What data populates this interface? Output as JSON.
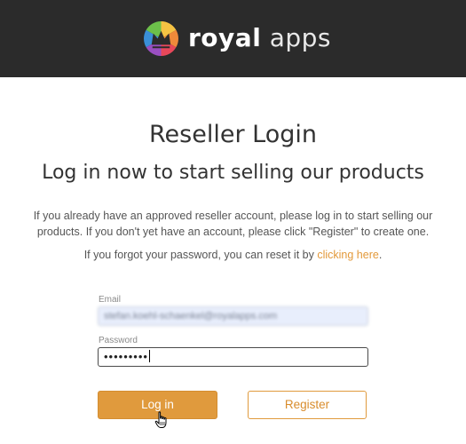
{
  "header": {
    "brand_bold": "royal",
    "brand_light": " apps",
    "logo_icon": "crown-logo-icon"
  },
  "main": {
    "title": "Reseller Login",
    "subtitle": "Log in now to start selling our products",
    "intro": "If you already have an approved reseller account, please log in to start selling our products. If you don't yet have an account, please click \"Register\" to create one.",
    "forgot_prefix": "If you forgot your password, you can reset it by ",
    "forgot_link": "clicking here",
    "forgot_suffix": "."
  },
  "form": {
    "email_label": "Email",
    "email_value": "stefan.koehl-schaenkel@royalapps.com",
    "password_label": "Password",
    "password_value": "•••••••••",
    "login_label": "Log in",
    "register_label": "Register"
  },
  "colors": {
    "header_bg": "#2b2b2b",
    "accent": "#e09a3d",
    "link": "#e3993a"
  }
}
